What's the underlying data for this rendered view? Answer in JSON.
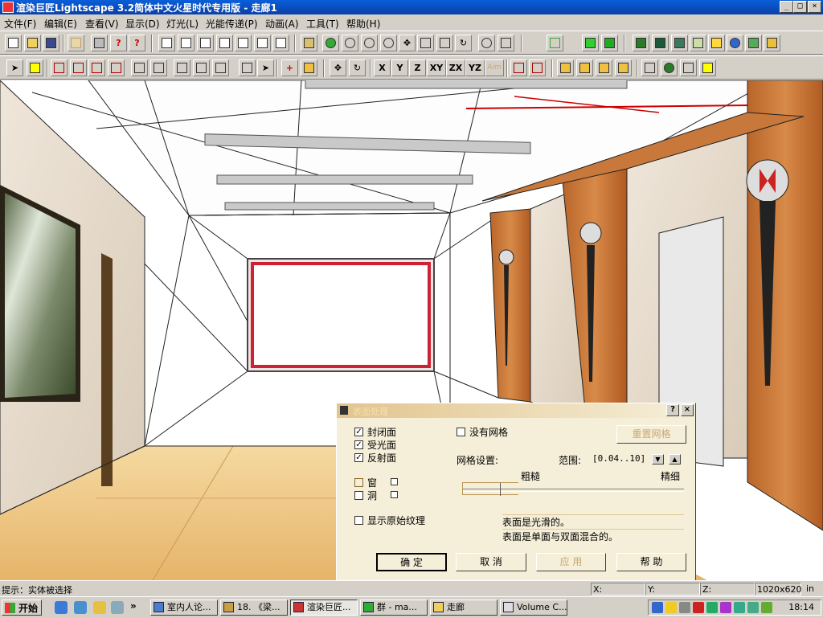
{
  "window": {
    "title": "渲染巨匠Lightscape 3.2简体中文火星时代专用版 - 走廊1",
    "controls": {
      "minimize": "_",
      "maximize": "□",
      "close": "×"
    }
  },
  "menu": [
    "文件(F)",
    "编辑(E)",
    "查看(V)",
    "显示(D)",
    "灯光(L)",
    "光能传递(P)",
    "动画(A)",
    "工具(T)",
    "帮助(H)"
  ],
  "toolbar2_text_buttons": [
    "X",
    "Y",
    "Z",
    "XY",
    "ZX",
    "YZ",
    "Aim"
  ],
  "dialog": {
    "title": "表面处理",
    "help_button": "?",
    "close_button": "×",
    "checkboxes": [
      {
        "label": "封闭面",
        "checked": true
      },
      {
        "label": "受光面",
        "checked": true
      },
      {
        "label": "反射面",
        "checked": true
      }
    ],
    "opening_checkboxes": [
      {
        "label": "窗",
        "checked": false
      },
      {
        "label": "洞",
        "checked": false
      }
    ],
    "no_mesh": {
      "label": "没有网格",
      "checked": false
    },
    "reset_mesh_button": "重置网格",
    "mesh_settings_label": "网格设置:",
    "range_label": "范围:",
    "range_value": "[0.04..10]",
    "coarse_label": "粗糙",
    "fine_label": "精细",
    "mesh_slider_position": 0.17,
    "show_texture": {
      "label": "显示原始纹理",
      "checked": false
    },
    "info_lines": [
      "表面是光滑的。",
      "表面是单面与双面混合的。"
    ],
    "buttons": {
      "ok": "确  定",
      "cancel": "取  消",
      "apply": "应  用",
      "help": "帮  助"
    }
  },
  "statusbar": {
    "hint": "提示：实体被选择",
    "x_label": "X:",
    "y_label": "Y:",
    "z_label": "Z:",
    "resolution": "1020x620",
    "units": "in"
  },
  "taskbar": {
    "start": "开始",
    "overflow": "»",
    "tasks": [
      "室内人论...",
      "18. 《梁...",
      "渲染巨匠...",
      "群 - ma...",
      "走廊",
      "Volume C..."
    ],
    "clock": "18:14"
  }
}
